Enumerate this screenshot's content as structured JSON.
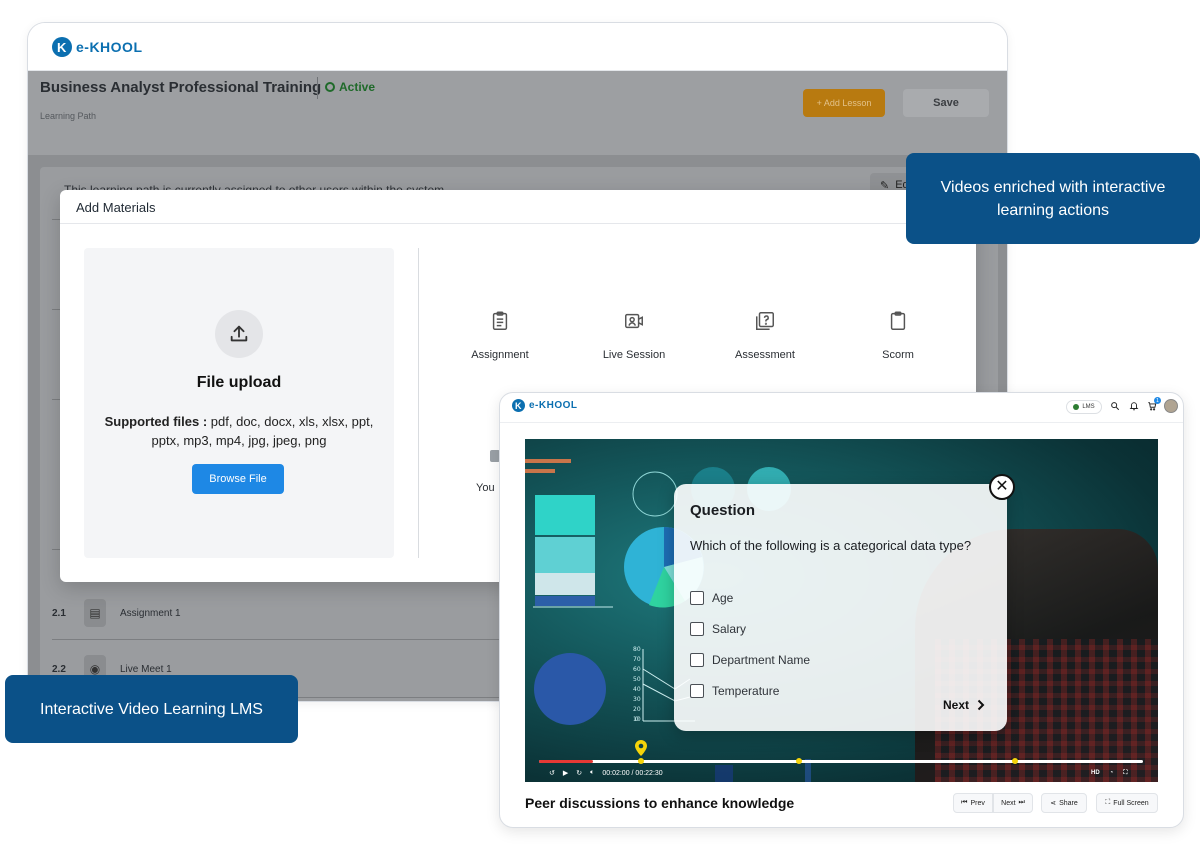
{
  "brand": {
    "logo_text": "e-KHOOL",
    "logo_mark": "K"
  },
  "back_window": {
    "course_title": "Business Analyst Professional Training",
    "status": "Active",
    "subtitle": "Learning Path",
    "add_lesson_label": "+ Add Lesson",
    "save_label": "Save",
    "assigned_note": "This learning path is currently assigned to other users within the system",
    "edit_label": "Ed",
    "lessons": [
      {
        "num": "2.1",
        "name": "Assignment 1"
      },
      {
        "num": "2.2",
        "name": "Live Meet 1"
      }
    ]
  },
  "modal": {
    "title": "Add Materials",
    "upload_title": "File upload",
    "supported_label": "Supported files :",
    "supported_types": "pdf, doc, docx, xls, xlsx, ppt, pptx, mp3, mp4, jpg, jpeg, png",
    "browse_label": "Browse File",
    "options": [
      "Assignment",
      "Live Session",
      "Assessment",
      "Scorm"
    ],
    "partial_option": "You"
  },
  "callouts": {
    "top": "Videos enriched with interactive learning actions",
    "bottom": "Interactive Video Learning LMS"
  },
  "front_window": {
    "lms_chip": "LMS",
    "cart_count": "1",
    "quiz": {
      "title": "Question",
      "question": "Which of the following is a categorical data type?",
      "options": [
        "Age",
        "Salary",
        "Department Name",
        "Temperature"
      ],
      "next_label": "Next"
    },
    "player": {
      "time": "00:02:00 / 00:22:30",
      "progress": 0.09,
      "quality": "HD"
    },
    "video_title": "Peer discussions to enhance knowledge",
    "footer": {
      "prev": "Prev",
      "next": "Next",
      "share": "Share",
      "fullscreen": "Full Screen"
    }
  },
  "colors": {
    "brand_blue": "#0b5188",
    "accent_blue": "#1e88e5",
    "active_green": "#1f6a2a",
    "progress_red": "#e53935",
    "marker_yellow": "#f5d40a"
  }
}
